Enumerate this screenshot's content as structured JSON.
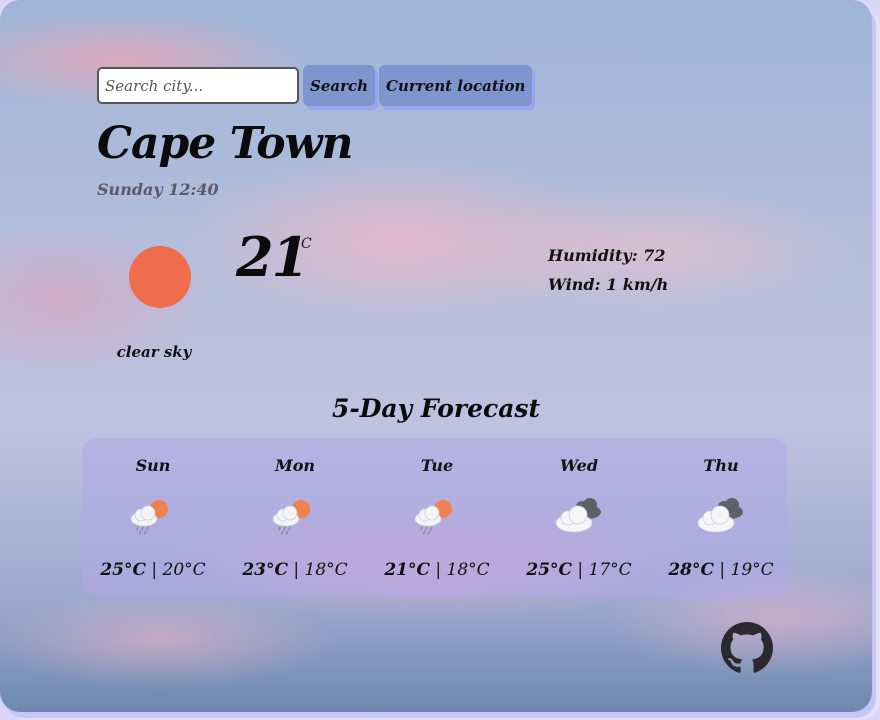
{
  "search": {
    "placeholder": "Search city...",
    "value": ""
  },
  "buttons": {
    "search": "Search",
    "current_location": "Current location"
  },
  "current": {
    "city": "Cape Town",
    "datetime": "Sunday 12:40",
    "temperature": "21",
    "unit": "°C",
    "description": "clear sky",
    "humidity": "Humidity: 72",
    "wind": "Wind: 1 km/h",
    "icon": "sun-icon"
  },
  "forecast": {
    "title": "5-Day Forecast",
    "days": [
      {
        "day": "Sun",
        "high": "25°C",
        "sep": "|",
        "low": "20°C",
        "icon": "sun-rain-cloud-icon"
      },
      {
        "day": "Mon",
        "high": "23°C",
        "sep": "|",
        "low": "18°C",
        "icon": "sun-rain-cloud-icon"
      },
      {
        "day": "Tue",
        "high": "21°C",
        "sep": "|",
        "low": "18°C",
        "icon": "sun-rain-cloud-icon"
      },
      {
        "day": "Wed",
        "high": "25°C",
        "sep": "|",
        "low": "17°C",
        "icon": "broken-clouds-icon"
      },
      {
        "day": "Thu",
        "high": "28°C",
        "sep": "|",
        "low": "19°C",
        "icon": "broken-clouds-icon"
      }
    ]
  },
  "footer": {
    "icon": "github-icon"
  },
  "colors": {
    "sun": "#ef6d4c",
    "button": "#7e95ce",
    "panel": "#b2a8e8"
  }
}
